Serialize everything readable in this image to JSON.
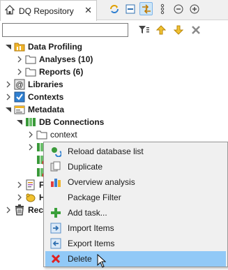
{
  "view": {
    "tab_title": "DQ Repository",
    "close_glyph": "✕"
  },
  "toolbar": {
    "buttons": [
      "refresh-icon",
      "collapse-all-icon",
      "link-with-editor-icon",
      "view-menu-icon",
      "minimize-icon",
      "maximize-icon"
    ]
  },
  "filter": {
    "value": "",
    "placeholder": "",
    "tools": [
      "filter-icon",
      "arrow-up-icon",
      "arrow-down-icon",
      "clear-icon"
    ]
  },
  "tree": {
    "items": [
      {
        "label": "Data Profiling",
        "bold": true,
        "expanded": true
      },
      {
        "label": "Analyses (10)",
        "bold": true
      },
      {
        "label": "Reports (6)",
        "bold": true
      },
      {
        "label": "Libraries",
        "bold": true
      },
      {
        "label": "Contexts",
        "bold": true
      },
      {
        "label": "Metadata",
        "bold": true,
        "expanded": true
      },
      {
        "label": "DB Connections",
        "bold": true,
        "expanded": true
      },
      {
        "label": "context",
        "bold": false
      },
      {
        "label": "F"
      },
      {
        "label": "H"
      },
      {
        "label": "Recy"
      }
    ]
  },
  "context_menu": {
    "items": [
      {
        "label": "Reload database list",
        "icon": "reload-icon"
      },
      {
        "label": "Duplicate",
        "icon": "duplicate-icon"
      },
      {
        "label": "Overview analysis",
        "icon": "overview-analysis-icon"
      },
      {
        "label": "Package Filter",
        "icon": ""
      },
      {
        "label": "Add task...",
        "icon": "add-task-icon"
      },
      {
        "label": "Import Items",
        "icon": "import-icon"
      },
      {
        "label": "Export Items",
        "icon": "export-icon"
      },
      {
        "label": "Delete",
        "icon": "delete-icon",
        "highlighted": true
      }
    ]
  },
  "colors": {
    "selection": "#cce8ff",
    "menu_hover": "#91c9f7",
    "folder_stroke": "#555555",
    "delete_red": "#e02020"
  }
}
